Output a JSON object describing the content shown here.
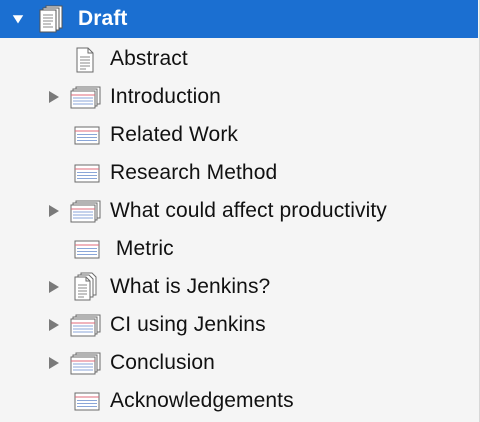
{
  "binder": {
    "root": {
      "label": "Draft",
      "icon": "draft-folder-icon",
      "expanded": true
    },
    "items": [
      {
        "label": "Abstract",
        "icon": "text-document-icon",
        "has_children": false
      },
      {
        "label": "Introduction",
        "icon": "stacked-index-cards-icon",
        "has_children": true
      },
      {
        "label": "Related Work",
        "icon": "index-card-icon",
        "has_children": false
      },
      {
        "label": "Research Method",
        "icon": "index-card-icon",
        "has_children": false
      },
      {
        "label": "What could affect productivity",
        "icon": "stacked-index-cards-icon",
        "has_children": true
      },
      {
        "label": " Metric",
        "icon": "index-card-icon",
        "has_children": false
      },
      {
        "label": "What is Jenkins?",
        "icon": "stacked-text-documents-icon",
        "has_children": true
      },
      {
        "label": "CI using Jenkins",
        "icon": "stacked-index-cards-icon",
        "has_children": true
      },
      {
        "label": "Conclusion",
        "icon": "stacked-index-cards-icon",
        "has_children": true
      },
      {
        "label": "Acknowledgements",
        "icon": "index-card-icon",
        "has_children": false
      }
    ],
    "colors": {
      "selection": "#1b6fd1",
      "background": "#f5f5f5",
      "text": "#111111",
      "disclosure": "#7a7a7a"
    }
  }
}
